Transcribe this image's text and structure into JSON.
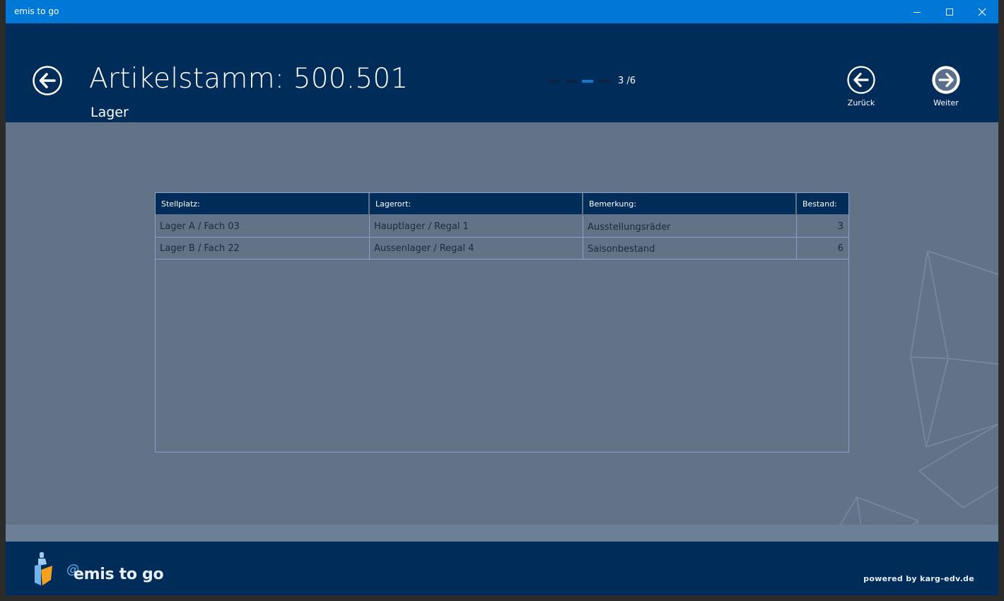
{
  "window": {
    "title": "emis to go"
  },
  "header": {
    "title": "Artikelstamm: 500.501",
    "subtitle": "Lager",
    "pager": {
      "current": 3,
      "total": 6,
      "label": "3 /6"
    },
    "back_label": "Zurück",
    "next_label": "Weiter"
  },
  "table": {
    "columns": [
      "Stellplatz:",
      "Lagerort:",
      "Bemerkung:",
      "Bestand:"
    ],
    "rows": [
      [
        "Lager A / Fach 03",
        "Hauptlager / Regal 1",
        "Ausstellungsräder",
        "3"
      ],
      [
        "Lager B / Fach 22",
        "Aussenlager / Regal 4",
        "Saisonbestand",
        "6"
      ]
    ]
  },
  "footer": {
    "logo_text": "emis to go",
    "powered_by": "powered by karg-edv.de"
  },
  "colors": {
    "titlebar": "#0078d7",
    "header": "#002c5a",
    "content": "#627388",
    "pager_active": "#1577d1"
  }
}
